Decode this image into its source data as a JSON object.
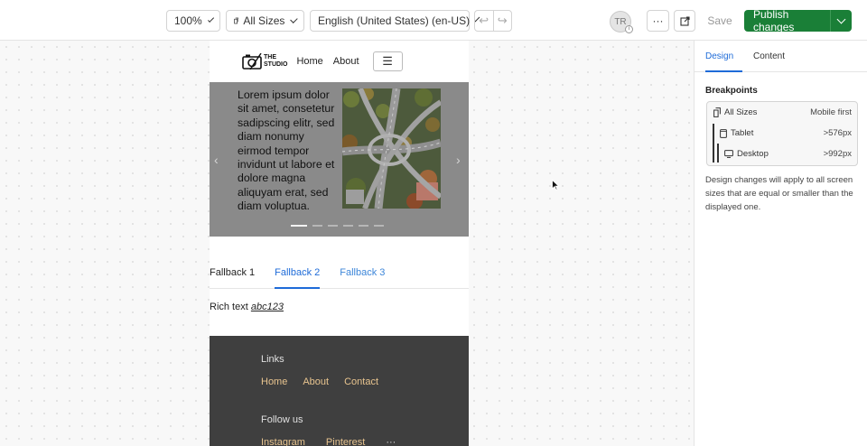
{
  "toolbar": {
    "zoom": "100%",
    "sizes": "All Sizes",
    "locale": "English (United States) (en-US)",
    "avatar_initials": "TR",
    "more": "···",
    "save_label": "Save",
    "publish_label": "Publish changes"
  },
  "site": {
    "logo_line1": "THE",
    "logo_line2": "STUDIO",
    "nav": [
      "Home",
      "About"
    ],
    "menu_glyph": "☰",
    "hero_text": "Lorem ipsum dolor sit amet, consetetur sadipscing elitr, sed diam nonumy eirmod tempor invidunt ut labore et dolore magna aliquyam erat, sed diam voluptua.",
    "carousel_dots": 6,
    "carousel_active": 0,
    "tabs": [
      "Fallback 1",
      "Fallback 2",
      "Fallback 3"
    ],
    "active_tab": 1,
    "richtext_prefix": "Rich text ",
    "richtext_italic": "abc123",
    "footer": {
      "links_heading": "Links",
      "links": [
        "Home",
        "About",
        "Contact"
      ],
      "follow_heading": "Follow us",
      "social": [
        "Instagram",
        "Pinterest",
        "···"
      ]
    }
  },
  "panel": {
    "tabs": [
      "Design",
      "Content"
    ],
    "active_tab": "Design",
    "breakpoints_title": "Breakpoints",
    "breakpoints": [
      {
        "label": "All Sizes",
        "value": "Mobile first"
      },
      {
        "label": "Tablet",
        "value": ">576px"
      },
      {
        "label": "Desktop",
        "value": ">992px"
      }
    ],
    "note": "Design changes will apply to all screen sizes that are equal or smaller than the displayed one."
  },
  "colors": {
    "accent": "#1e6bd8",
    "publish": "#1a7f37",
    "hero_bg": "#8a8a8a",
    "footer_bg": "#3f3f3f",
    "footer_link": "#e8c48f"
  }
}
